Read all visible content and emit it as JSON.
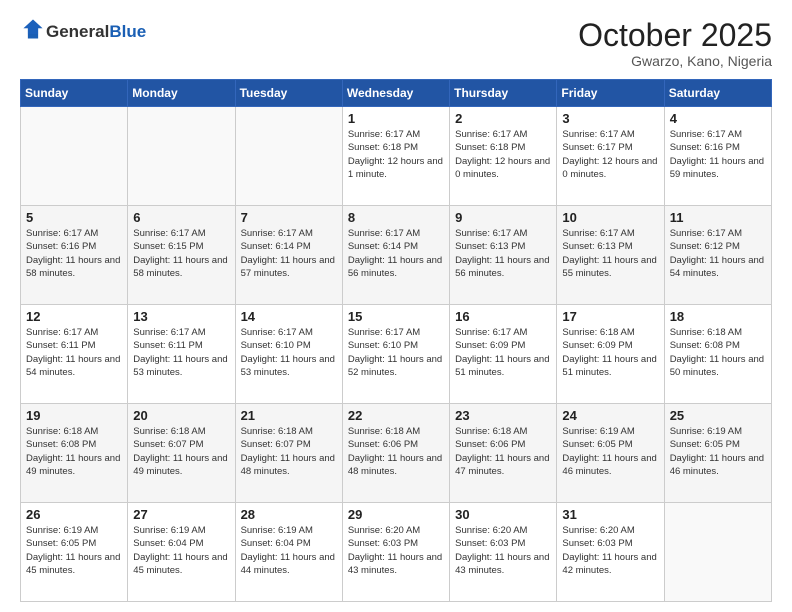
{
  "header": {
    "logo": {
      "general": "General",
      "blue": "Blue"
    },
    "title": "October 2025",
    "location": "Gwarzo, Kano, Nigeria"
  },
  "weekdays": [
    "Sunday",
    "Monday",
    "Tuesday",
    "Wednesday",
    "Thursday",
    "Friday",
    "Saturday"
  ],
  "weeks": [
    [
      {
        "day": "",
        "info": ""
      },
      {
        "day": "",
        "info": ""
      },
      {
        "day": "",
        "info": ""
      },
      {
        "day": "1",
        "info": "Sunrise: 6:17 AM\nSunset: 6:18 PM\nDaylight: 12 hours\nand 1 minute."
      },
      {
        "day": "2",
        "info": "Sunrise: 6:17 AM\nSunset: 6:18 PM\nDaylight: 12 hours\nand 0 minutes."
      },
      {
        "day": "3",
        "info": "Sunrise: 6:17 AM\nSunset: 6:17 PM\nDaylight: 12 hours\nand 0 minutes."
      },
      {
        "day": "4",
        "info": "Sunrise: 6:17 AM\nSunset: 6:16 PM\nDaylight: 11 hours\nand 59 minutes."
      }
    ],
    [
      {
        "day": "5",
        "info": "Sunrise: 6:17 AM\nSunset: 6:16 PM\nDaylight: 11 hours\nand 58 minutes."
      },
      {
        "day": "6",
        "info": "Sunrise: 6:17 AM\nSunset: 6:15 PM\nDaylight: 11 hours\nand 58 minutes."
      },
      {
        "day": "7",
        "info": "Sunrise: 6:17 AM\nSunset: 6:14 PM\nDaylight: 11 hours\nand 57 minutes."
      },
      {
        "day": "8",
        "info": "Sunrise: 6:17 AM\nSunset: 6:14 PM\nDaylight: 11 hours\nand 56 minutes."
      },
      {
        "day": "9",
        "info": "Sunrise: 6:17 AM\nSunset: 6:13 PM\nDaylight: 11 hours\nand 56 minutes."
      },
      {
        "day": "10",
        "info": "Sunrise: 6:17 AM\nSunset: 6:13 PM\nDaylight: 11 hours\nand 55 minutes."
      },
      {
        "day": "11",
        "info": "Sunrise: 6:17 AM\nSunset: 6:12 PM\nDaylight: 11 hours\nand 54 minutes."
      }
    ],
    [
      {
        "day": "12",
        "info": "Sunrise: 6:17 AM\nSunset: 6:11 PM\nDaylight: 11 hours\nand 54 minutes."
      },
      {
        "day": "13",
        "info": "Sunrise: 6:17 AM\nSunset: 6:11 PM\nDaylight: 11 hours\nand 53 minutes."
      },
      {
        "day": "14",
        "info": "Sunrise: 6:17 AM\nSunset: 6:10 PM\nDaylight: 11 hours\nand 53 minutes."
      },
      {
        "day": "15",
        "info": "Sunrise: 6:17 AM\nSunset: 6:10 PM\nDaylight: 11 hours\nand 52 minutes."
      },
      {
        "day": "16",
        "info": "Sunrise: 6:17 AM\nSunset: 6:09 PM\nDaylight: 11 hours\nand 51 minutes."
      },
      {
        "day": "17",
        "info": "Sunrise: 6:18 AM\nSunset: 6:09 PM\nDaylight: 11 hours\nand 51 minutes."
      },
      {
        "day": "18",
        "info": "Sunrise: 6:18 AM\nSunset: 6:08 PM\nDaylight: 11 hours\nand 50 minutes."
      }
    ],
    [
      {
        "day": "19",
        "info": "Sunrise: 6:18 AM\nSunset: 6:08 PM\nDaylight: 11 hours\nand 49 minutes."
      },
      {
        "day": "20",
        "info": "Sunrise: 6:18 AM\nSunset: 6:07 PM\nDaylight: 11 hours\nand 49 minutes."
      },
      {
        "day": "21",
        "info": "Sunrise: 6:18 AM\nSunset: 6:07 PM\nDaylight: 11 hours\nand 48 minutes."
      },
      {
        "day": "22",
        "info": "Sunrise: 6:18 AM\nSunset: 6:06 PM\nDaylight: 11 hours\nand 48 minutes."
      },
      {
        "day": "23",
        "info": "Sunrise: 6:18 AM\nSunset: 6:06 PM\nDaylight: 11 hours\nand 47 minutes."
      },
      {
        "day": "24",
        "info": "Sunrise: 6:19 AM\nSunset: 6:05 PM\nDaylight: 11 hours\nand 46 minutes."
      },
      {
        "day": "25",
        "info": "Sunrise: 6:19 AM\nSunset: 6:05 PM\nDaylight: 11 hours\nand 46 minutes."
      }
    ],
    [
      {
        "day": "26",
        "info": "Sunrise: 6:19 AM\nSunset: 6:05 PM\nDaylight: 11 hours\nand 45 minutes."
      },
      {
        "day": "27",
        "info": "Sunrise: 6:19 AM\nSunset: 6:04 PM\nDaylight: 11 hours\nand 45 minutes."
      },
      {
        "day": "28",
        "info": "Sunrise: 6:19 AM\nSunset: 6:04 PM\nDaylight: 11 hours\nand 44 minutes."
      },
      {
        "day": "29",
        "info": "Sunrise: 6:20 AM\nSunset: 6:03 PM\nDaylight: 11 hours\nand 43 minutes."
      },
      {
        "day": "30",
        "info": "Sunrise: 6:20 AM\nSunset: 6:03 PM\nDaylight: 11 hours\nand 43 minutes."
      },
      {
        "day": "31",
        "info": "Sunrise: 6:20 AM\nSunset: 6:03 PM\nDaylight: 11 hours\nand 42 minutes."
      },
      {
        "day": "",
        "info": ""
      }
    ]
  ]
}
